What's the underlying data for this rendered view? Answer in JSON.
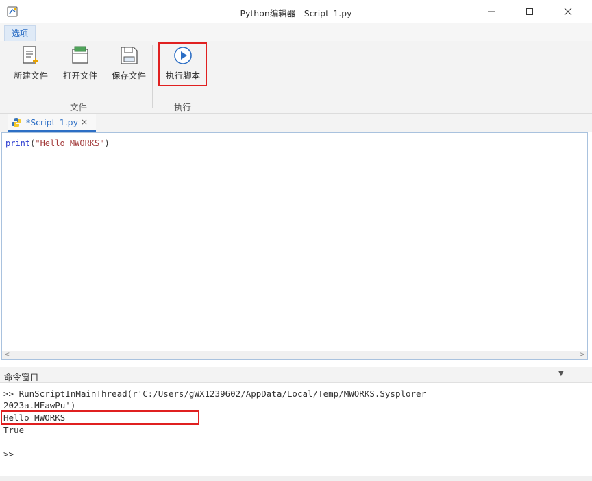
{
  "window": {
    "title": "Python编辑器 - Script_1.py",
    "icons": {
      "app": "python-editor-icon",
      "minimize": "minimize-icon",
      "maximize": "maximize-icon",
      "close": "close-icon"
    }
  },
  "ribbon": {
    "tab_label": "选项",
    "groups": [
      {
        "label": "文件",
        "buttons": [
          {
            "label": "新建文件",
            "icon": "new-file-icon"
          },
          {
            "label": "打开文件",
            "icon": "open-file-icon"
          },
          {
            "label": "保存文件",
            "icon": "save-file-icon"
          }
        ]
      },
      {
        "label": "执行",
        "buttons": [
          {
            "label": "执行脚本",
            "icon": "run-script-icon"
          }
        ]
      }
    ]
  },
  "editor": {
    "tab": {
      "label": "*Script_1.py",
      "close": "×",
      "icon": "python-file-icon"
    },
    "code": {
      "keyword": "print",
      "open": "(",
      "string": "\"Hello MWORKS\"",
      "close": ")"
    }
  },
  "command_window": {
    "title": "命令窗口",
    "dropdown_glyph": "▼",
    "minimize_glyph": "—",
    "lines": [
      ">> RunScriptInMainThread(r'C:/Users/gWX1239602/AppData/Local/Temp/MWORKS.Sysplorer",
      "2023a.MFawPu')",
      "Hello MWORKS",
      "True",
      "",
      ">>"
    ]
  },
  "colors": {
    "accent": "#2d6fc5",
    "highlight_box": "#e02020",
    "keyword": "#2a3bd0",
    "string": "#a33b3b"
  }
}
